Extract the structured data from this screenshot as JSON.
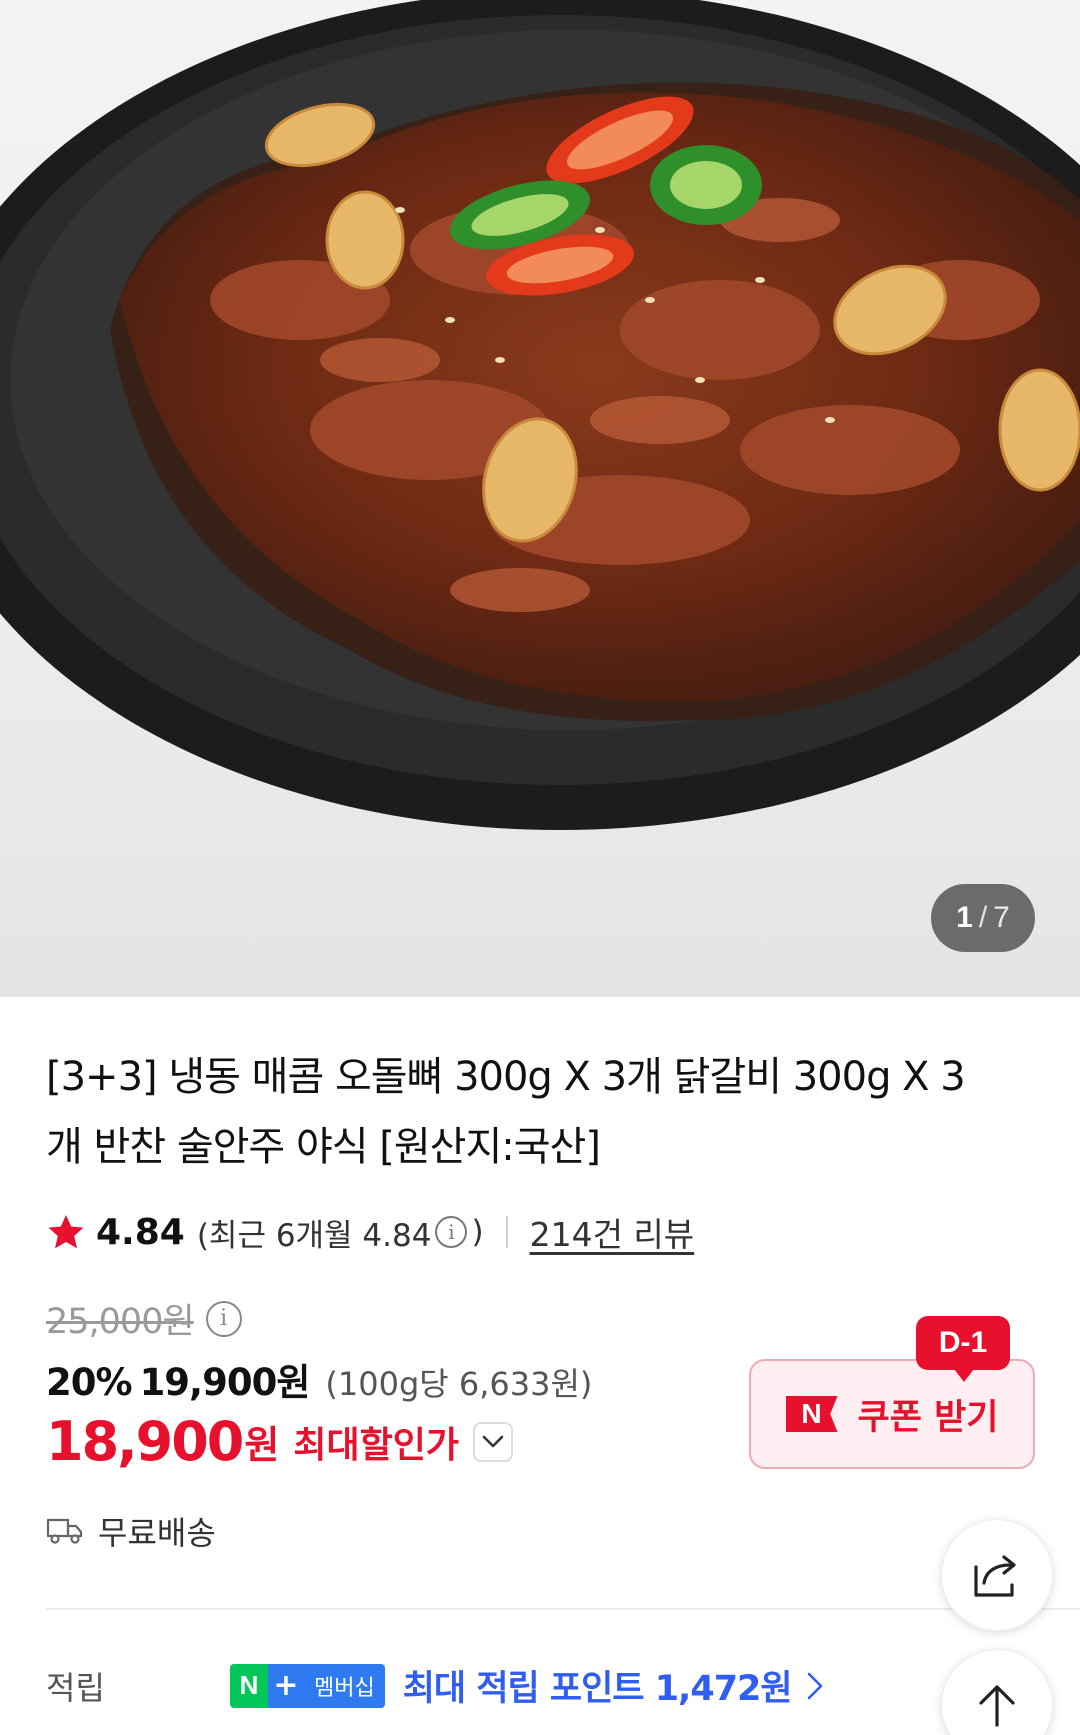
{
  "gallery": {
    "current": "1",
    "separator": "/",
    "total": "7"
  },
  "product": {
    "title": "[3+3] 냉동 매콤 오돌뼈 300g X 3개 닭갈비 300g X 3개 반찬 술안주 야식 [원산지:국산]"
  },
  "rating": {
    "score": "4.84",
    "recent_label": "(최근 6개월 4.84",
    "recent_close": ")",
    "info_icon": "i",
    "reviews_label": "214건 리뷰"
  },
  "price": {
    "original": "25,000원",
    "discount_percent": "20%",
    "sale_price": "19,900원",
    "unit_price": "(100g당 6,633원)",
    "max_discount_amount": "18,900",
    "max_discount_currency": "원",
    "max_discount_label": "최대할인가"
  },
  "coupon": {
    "badge": "D-1",
    "logo": "N",
    "label": "쿠폰 받기"
  },
  "shipping": {
    "label": "무료배송"
  },
  "points": {
    "label": "적립",
    "badge_n": "N",
    "badge_plus": "+",
    "badge_membership": "멤버십",
    "text": "최대 적립 포인트 1,472원"
  },
  "colors": {
    "accent_red": "#e8112d",
    "naver_green": "#03c75a",
    "membership_blue": "#2f5ef0"
  },
  "icons": [
    "star-icon",
    "info-icon",
    "chevron-down-icon",
    "truck-icon",
    "chevron-right-icon",
    "share-icon",
    "arrow-up-icon"
  ]
}
